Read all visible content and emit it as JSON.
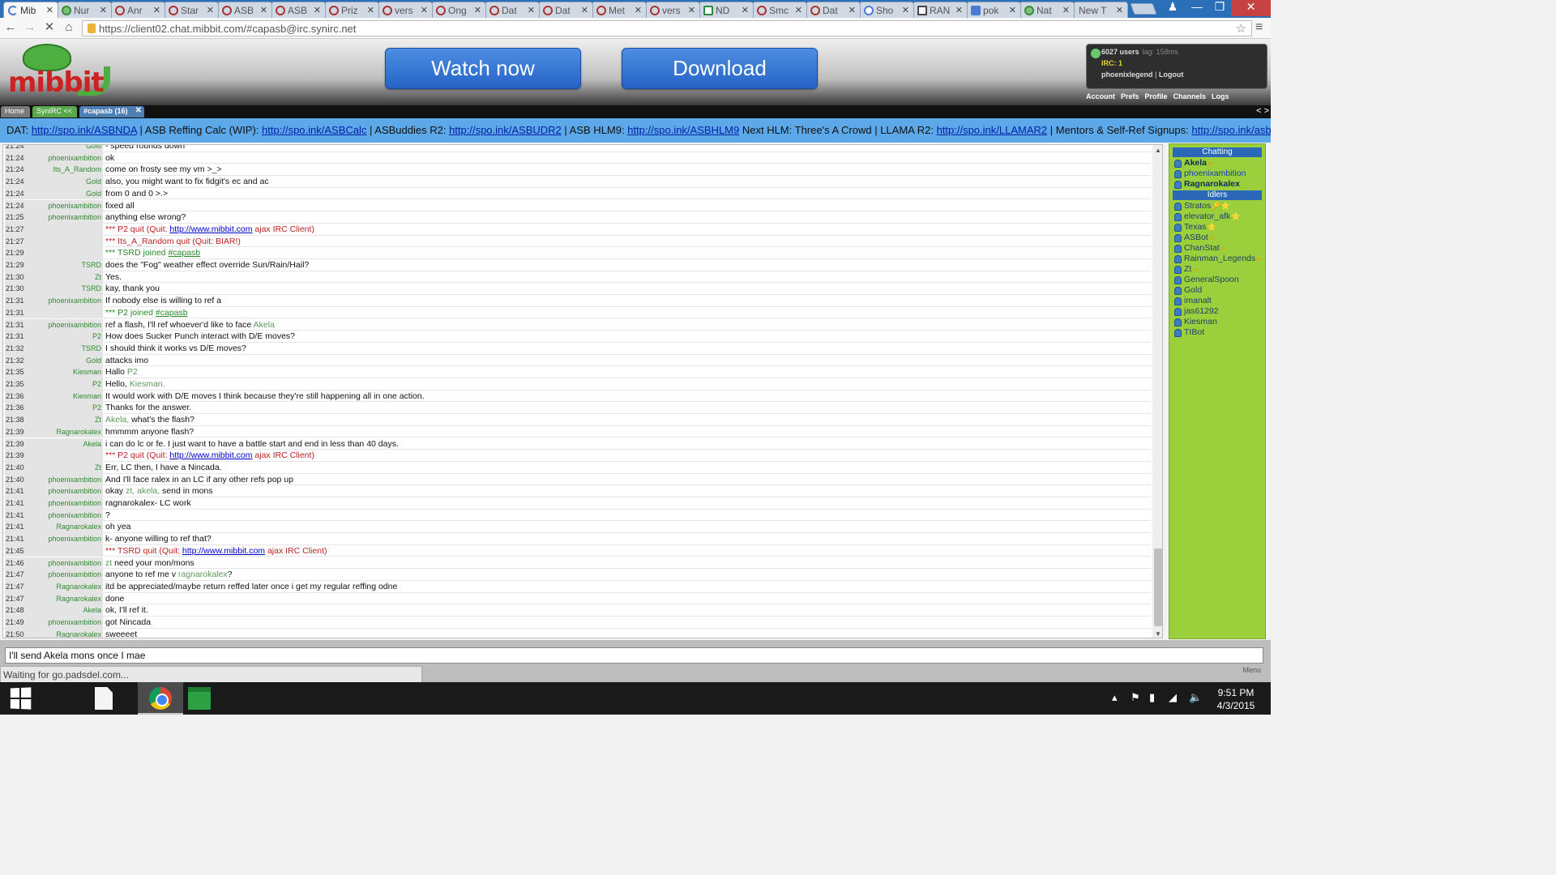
{
  "browser": {
    "tabs": [
      {
        "label": "Mib",
        "icon": "loading-icon"
      },
      {
        "label": "Nur",
        "icon": "leaf-icon"
      },
      {
        "label": "Anr",
        "icon": "pokeball-icon"
      },
      {
        "label": "Star",
        "icon": "pokeball-icon"
      },
      {
        "label": "ASB",
        "icon": "pokeball-icon"
      },
      {
        "label": "ASB",
        "icon": "pokeball-icon"
      },
      {
        "label": "Priz",
        "icon": "pokeball-icon"
      },
      {
        "label": "vers",
        "icon": "pokeball-icon"
      },
      {
        "label": "Ong",
        "icon": "pokeball-icon"
      },
      {
        "label": "Dat",
        "icon": "pokeball-icon"
      },
      {
        "label": "Dat",
        "icon": "pokeball-icon"
      },
      {
        "label": "Met",
        "icon": "pokeball-icon"
      },
      {
        "label": "vers",
        "icon": "pokeball-icon"
      },
      {
        "label": "ND",
        "icon": "spreadsheet-icon"
      },
      {
        "label": "Smc",
        "icon": "pokeball-icon"
      },
      {
        "label": "Dat",
        "icon": "pokeball-icon"
      },
      {
        "label": "Sho",
        "icon": "s-icon"
      },
      {
        "label": "RAN",
        "icon": "r-icon"
      },
      {
        "label": "pok",
        "icon": "google-icon"
      },
      {
        "label": "Nat",
        "icon": "leaf-icon"
      },
      {
        "label": "New T",
        "icon": ""
      }
    ],
    "url": "https://client02.chat.mibbit.com/#capasb@irc.synirc.net",
    "status": "Waiting for go.padsdel.com..."
  },
  "header": {
    "logo_text": "mibbit",
    "watch_label": "Watch now",
    "download_label": "Download",
    "users_count": "6027 users",
    "lag": "lag: 158ms",
    "irc_count": "IRC: 1",
    "username": "phoenixlegend",
    "logout": "Logout",
    "links": [
      "Account",
      "Prefs",
      "Profile",
      "Channels",
      "Logs"
    ]
  },
  "tabbar": {
    "home": "Home",
    "server": "SynIRC <<",
    "channel": "#capasb (16)",
    "arrows": "< >"
  },
  "topic": [
    {
      "t": "DAT: "
    },
    {
      "t": "http://spo.ink/ASBNDA",
      "link": true
    },
    {
      "t": " | ASB Reffing Calc (WIP): "
    },
    {
      "t": "http://spo.ink/ASBCalc",
      "link": true
    },
    {
      "t": " | ASBuddies R2: "
    },
    {
      "t": "http://spo.ink/ASBUDR2",
      "link": true
    },
    {
      "t": " | ASB HLM9: "
    },
    {
      "t": "http://spo.ink/ASBHLM9",
      "link": true
    },
    {
      "t": " Next HLM: Three's A Crowd | LLAMA R2: "
    },
    {
      "t": "http://spo.ink/LLAMAR2",
      "link": true
    },
    {
      "t": " | Mentors & Self-Ref Signups: "
    },
    {
      "t": "http://spo.ink/asbmentor",
      "link": true
    }
  ],
  "messages": [
    {
      "time": "21:24",
      "nick": "Gold",
      "parts": [
        {
          "t": "- speed rounds down"
        }
      ]
    },
    {
      "time": "21:24",
      "nick": "phoenixambition",
      "parts": [
        {
          "t": "ok"
        }
      ]
    },
    {
      "time": "21:24",
      "nick": "Its_A_Random",
      "parts": [
        {
          "t": "come on frosty see my vm >_>"
        }
      ]
    },
    {
      "time": "21:24",
      "nick": "Gold",
      "parts": [
        {
          "t": "also, you might want to fix fidgit's ec and ac"
        }
      ]
    },
    {
      "time": "21:24",
      "nick": "Gold",
      "parts": [
        {
          "t": "from 0 and 0 >.>"
        }
      ]
    },
    {
      "time": "21:24",
      "nick": "phoenixambition",
      "parts": [
        {
          "t": "fixed all"
        }
      ]
    },
    {
      "time": "21:25",
      "nick": "phoenixambition",
      "parts": [
        {
          "t": "anything else wrong?"
        }
      ]
    },
    {
      "time": "21:27",
      "nick": "",
      "kind": "quit",
      "parts": [
        {
          "t": "*** P2 quit (Quit: "
        },
        {
          "t": "http://www.mibbit.com",
          "link": true
        },
        {
          "t": " ajax IRC Client)"
        }
      ]
    },
    {
      "time": "21:27",
      "nick": "",
      "kind": "quit",
      "parts": [
        {
          "t": "*** Its_A_Random quit (Quit: BIAR!)"
        }
      ]
    },
    {
      "time": "21:29",
      "nick": "",
      "kind": "join",
      "parts": [
        {
          "t": "*** TSRD joined "
        },
        {
          "t": "#capasb",
          "join_link": true
        }
      ]
    },
    {
      "time": "21:29",
      "nick": "TSRD",
      "parts": [
        {
          "t": "does the \"Fog\" weather effect override Sun/Rain/Hail?"
        }
      ]
    },
    {
      "time": "21:30",
      "nick": "Zt",
      "parts": [
        {
          "t": "Yes."
        }
      ]
    },
    {
      "time": "21:30",
      "nick": "TSRD",
      "parts": [
        {
          "t": "kay, thank you"
        }
      ]
    },
    {
      "time": "21:31",
      "nick": "phoenixambition",
      "parts": [
        {
          "t": "If nobody else is willing to ref a"
        }
      ]
    },
    {
      "time": "21:31",
      "nick": "",
      "kind": "join",
      "parts": [
        {
          "t": "*** P2 joined "
        },
        {
          "t": "#capasb",
          "join_link": true
        }
      ]
    },
    {
      "time": "21:31",
      "nick": "phoenixambition",
      "parts": [
        {
          "t": "ref a flash, I'll ref whoever'd like to face "
        },
        {
          "t": "Akela",
          "hl": true
        }
      ]
    },
    {
      "time": "21:31",
      "nick": "P2",
      "parts": [
        {
          "t": "How does Sucker Punch interact with D/E moves?"
        }
      ]
    },
    {
      "time": "21:32",
      "nick": "TSRD",
      "parts": [
        {
          "t": "I should think it works vs D/E moves?"
        }
      ]
    },
    {
      "time": "21:32",
      "nick": "Gold",
      "parts": [
        {
          "t": "attacks imo"
        }
      ]
    },
    {
      "time": "21:35",
      "nick": "Kiesman",
      "parts": [
        {
          "t": "Hallo "
        },
        {
          "t": "P2",
          "hl": true
        }
      ]
    },
    {
      "time": "21:35",
      "nick": "P2",
      "parts": [
        {
          "t": "Hello, "
        },
        {
          "t": "Kiesman.",
          "hl": true
        }
      ]
    },
    {
      "time": "21:36",
      "nick": "Kiesman",
      "parts": [
        {
          "t": "It would work with D/E moves I think because they're still happening all in one action."
        }
      ]
    },
    {
      "time": "21:36",
      "nick": "P2",
      "parts": [
        {
          "t": "Thanks for the answer."
        }
      ]
    },
    {
      "time": "21:38",
      "nick": "Zt",
      "parts": [
        {
          "t": "Akela,",
          "hl": true
        },
        {
          "t": " what's the flash?"
        }
      ]
    },
    {
      "time": "21:39",
      "nick": "Ragnarokalex",
      "parts": [
        {
          "t": "hmmmm anyone flash?"
        }
      ]
    },
    {
      "time": "21:39",
      "nick": "Akela",
      "parts": [
        {
          "t": "i can do lc or fe. I just want to have a battle start and end in less than 40 days."
        }
      ]
    },
    {
      "time": "21:39",
      "nick": "",
      "kind": "quit",
      "parts": [
        {
          "t": "*** P2 quit (Quit: "
        },
        {
          "t": "http://www.mibbit.com",
          "link": true
        },
        {
          "t": " ajax IRC Client)"
        }
      ]
    },
    {
      "time": "21:40",
      "nick": "Zt",
      "parts": [
        {
          "t": "Err, LC then, I have a Nincada."
        }
      ]
    },
    {
      "time": "21:40",
      "nick": "phoenixambition",
      "parts": [
        {
          "t": "And I'll face ralex in an LC if any other refs pop up"
        }
      ]
    },
    {
      "time": "21:41",
      "nick": "phoenixambition",
      "parts": [
        {
          "t": "okay "
        },
        {
          "t": "zt, akela,",
          "hl": true
        },
        {
          "t": " send in mons"
        }
      ]
    },
    {
      "time": "21:41",
      "nick": "phoenixambition",
      "parts": [
        {
          "t": "ragnarokalex- LC work"
        }
      ]
    },
    {
      "time": "21:41",
      "nick": "phoenixambition",
      "parts": [
        {
          "t": "?"
        }
      ]
    },
    {
      "time": "21:41",
      "nick": "Ragnarokalex",
      "parts": [
        {
          "t": "oh yea"
        }
      ]
    },
    {
      "time": "21:41",
      "nick": "phoenixambition",
      "parts": [
        {
          "t": "k- anyone willing to ref that?"
        }
      ]
    },
    {
      "time": "21:45",
      "nick": "",
      "kind": "quit",
      "parts": [
        {
          "t": "*** TSRD quit (Quit: "
        },
        {
          "t": "http://www.mibbit.com",
          "link": true
        },
        {
          "t": " ajax IRC Client)"
        }
      ]
    },
    {
      "time": "21:46",
      "nick": "phoenixambition",
      "parts": [
        {
          "t": "zt",
          "hl": true
        },
        {
          "t": " need your mon/mons"
        }
      ]
    },
    {
      "time": "21:47",
      "nick": "phoenixambition",
      "parts": [
        {
          "t": "anyone to ref me v "
        },
        {
          "t": "ragnarokalex",
          "hl": true
        },
        {
          "t": "?"
        }
      ]
    },
    {
      "time": "21:47",
      "nick": "Ragnarokalex",
      "parts": [
        {
          "t": "itd be appreciated/maybe return reffed later once i get my regular reffing odne"
        }
      ]
    },
    {
      "time": "21:47",
      "nick": "Ragnarokalex",
      "parts": [
        {
          "t": "done"
        }
      ]
    },
    {
      "time": "21:48",
      "nick": "Akela",
      "parts": [
        {
          "t": "ok, I'll ref it."
        }
      ]
    },
    {
      "time": "21:49",
      "nick": "phoenixambition",
      "parts": [
        {
          "t": "got Nincada"
        }
      ]
    },
    {
      "time": "21:50",
      "nick": "Ragnarokalex",
      "parts": [
        {
          "t": "sweeeet"
        }
      ]
    }
  ],
  "userlist": {
    "chatting_label": "Chatting",
    "idlers_label": "Idlers",
    "chatting": [
      {
        "name": "Akela",
        "badge": "◂",
        "style": "op"
      },
      {
        "name": "phoenixambition",
        "badge": "",
        "style": "me"
      },
      {
        "name": "Ragnarokalex",
        "badge": "",
        "style": "op"
      }
    ],
    "idlers": [
      {
        "name": "Stratos",
        "badge": "🔑⭐"
      },
      {
        "name": "elevator_afk",
        "badge": "⭐"
      },
      {
        "name": "Texas",
        "badge": "⭐"
      },
      {
        "name": "ASBot",
        "badge": "◂"
      },
      {
        "name": "ChanStat",
        "badge": "◂"
      },
      {
        "name": "Rainman_Legends",
        "badge": "◂"
      },
      {
        "name": "Zt",
        "badge": "◂"
      },
      {
        "name": "GeneralSpoon",
        "badge": ""
      },
      {
        "name": "Gold",
        "badge": ""
      },
      {
        "name": "imanalt",
        "badge": ""
      },
      {
        "name": "jas61292",
        "badge": ""
      },
      {
        "name": "Kiesman",
        "badge": ""
      },
      {
        "name": "TIBot",
        "badge": ""
      }
    ]
  },
  "input": {
    "value": "I'll send Akela mons once I mae ",
    "menu_label": "Menu"
  },
  "taskbar": {
    "time": "9:51 PM",
    "date": "4/3/2015"
  }
}
